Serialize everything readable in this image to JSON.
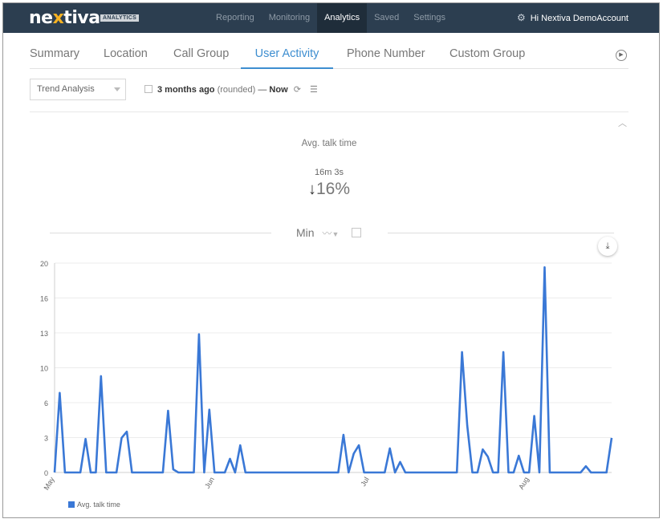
{
  "brand": {
    "name_pre": "ne",
    "name_x": "x",
    "name_post": "tiva",
    "badge": "ANALYTICS"
  },
  "topnav": [
    {
      "label": "Reporting",
      "active": false
    },
    {
      "label": "Monitoring",
      "active": false
    },
    {
      "label": "Analytics",
      "active": true
    },
    {
      "label": "Saved",
      "active": false
    },
    {
      "label": "Settings",
      "active": false
    }
  ],
  "account": {
    "greeting": "Hi Nextiva DemoAccount",
    "icon": "gear-icon"
  },
  "tabs": [
    {
      "label": "Summary",
      "active": false
    },
    {
      "label": "Location",
      "active": false
    },
    {
      "label": "Call Group",
      "active": false
    },
    {
      "label": "User Activity",
      "active": true
    },
    {
      "label": "Phone Number",
      "active": false
    },
    {
      "label": "Custom Group",
      "active": false
    }
  ],
  "controls": {
    "view_select": "Trend Analysis",
    "range_start": "3 months ago",
    "range_note": "(rounded)",
    "range_sep": "—",
    "range_end": "Now"
  },
  "metric": {
    "label": "Avg. talk time",
    "value": "16m 3s",
    "change": "16%",
    "direction": "down"
  },
  "chart_header": {
    "title": "Min"
  },
  "colors": {
    "topbar": "#2c3e50",
    "accent": "#3e8ed0",
    "series": "#3a78d6"
  },
  "chart_data": {
    "type": "line",
    "title": "",
    "ylabel": "",
    "xlabel": "",
    "yticks": [
      "0",
      "3",
      "6",
      "10",
      "13",
      "16",
      "20"
    ],
    "ylim": [
      0,
      20
    ],
    "xticks": [
      {
        "label": "May",
        "at": 0
      },
      {
        "label": "Jun",
        "at": 31
      },
      {
        "label": "Jul",
        "at": 61
      },
      {
        "label": "Aug",
        "at": 92
      }
    ],
    "grid": "horizontal",
    "legend_position": "bottom-left",
    "series": [
      {
        "name": "Avg. talk time",
        "points": [
          [
            0,
            0
          ],
          [
            1,
            7.6
          ],
          [
            2,
            0
          ],
          [
            5,
            0
          ],
          [
            6,
            3.2
          ],
          [
            7,
            0
          ],
          [
            8,
            0
          ],
          [
            9,
            9.2
          ],
          [
            10,
            0
          ],
          [
            12,
            0
          ],
          [
            13,
            3.3
          ],
          [
            14,
            3.9
          ],
          [
            15,
            0
          ],
          [
            21,
            0
          ],
          [
            22,
            5.9
          ],
          [
            23,
            0.3
          ],
          [
            24,
            0
          ],
          [
            27,
            0
          ],
          [
            28,
            13.2
          ],
          [
            29,
            0
          ],
          [
            30,
            6
          ],
          [
            31,
            0
          ],
          [
            33,
            0
          ],
          [
            34,
            1.3
          ],
          [
            35,
            0
          ],
          [
            36,
            2.6
          ],
          [
            37,
            0
          ],
          [
            55,
            0
          ],
          [
            56,
            3.6
          ],
          [
            57,
            0
          ],
          [
            58,
            1.8
          ],
          [
            59,
            2.6
          ],
          [
            60,
            0
          ],
          [
            64,
            0
          ],
          [
            65,
            2.3
          ],
          [
            66,
            0
          ],
          [
            67,
            1
          ],
          [
            68,
            0
          ],
          [
            78,
            0
          ],
          [
            79,
            11.5
          ],
          [
            80,
            4.5
          ],
          [
            81,
            0
          ],
          [
            82,
            0
          ],
          [
            83,
            2.2
          ],
          [
            84,
            1.5
          ],
          [
            85,
            0
          ],
          [
            86,
            0
          ],
          [
            87,
            11.5
          ],
          [
            88,
            0
          ],
          [
            89,
            0
          ],
          [
            90,
            1.6
          ],
          [
            91,
            0
          ],
          [
            92,
            0
          ],
          [
            93,
            5.4
          ],
          [
            94,
            0
          ],
          [
            95,
            19.6
          ],
          [
            96,
            0
          ],
          [
            102,
            0
          ],
          [
            103,
            0.6
          ],
          [
            104,
            0
          ],
          [
            107,
            0
          ],
          [
            108,
            3.3
          ]
        ]
      }
    ]
  }
}
